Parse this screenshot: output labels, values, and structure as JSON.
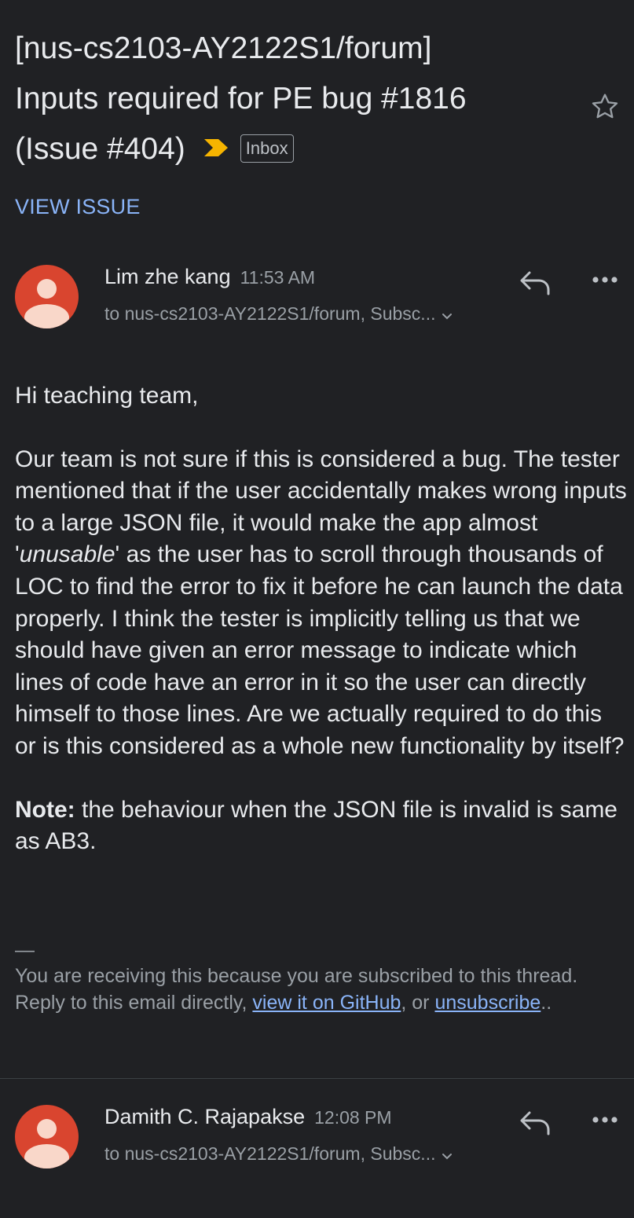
{
  "subject": {
    "line1": "[nus-cs2103-AY2122S1/forum]",
    "line2": "Inputs required for PE bug #1816",
    "line3": "(Issue #404)",
    "label": "Inbox",
    "important_icon": "important-marker-icon",
    "star_icon": "star-outline-icon"
  },
  "view_issue_label": "VIEW ISSUE",
  "messages": [
    {
      "sender": "Lim zhe kang",
      "time": "11:53 AM",
      "recipients": "to nus-cs2103-AY2122S1/forum, Subsc...",
      "greeting": "Hi teaching team,",
      "body_before_em": "Our team is not sure if this is considered a bug. The tester mentioned that if the user accidentally makes wrong inputs to a large JSON file, it would make the app almost '",
      "body_em": "unusable",
      "body_after_em": "' as the user has to scroll through thousands of LOC to find the error to fix it before he can launch the data properly. I think the tester is implicitly telling us that we should have given an error message to indicate which lines of code have an error in it so the user can directly himself to those lines. Are we actually required to do this or is this considered as a whole new functionality by itself?",
      "note_label": "Note:",
      "note_text": " the behaviour when the JSON file is invalid is same as AB3.",
      "footer_dash": "—",
      "footer_line1": "You are receiving this because you are subscribed to this thread.",
      "footer_reply_prefix": "Reply to this email directly, ",
      "footer_link_github": "view it on GitHub",
      "footer_middle": ", or ",
      "footer_link_unsub": "unsubscribe",
      "footer_end": ".."
    },
    {
      "sender": "Damith C. Rajapakse",
      "time": "12:08 PM",
      "recipients": "to nus-cs2103-AY2122S1/forum, Subsc..."
    }
  ],
  "colors": {
    "background": "#202124",
    "text": "#e8eaed",
    "secondary": "#9aa0a6",
    "link": "#8ab4f8",
    "avatar": "#d9452f",
    "important": "#f6b400"
  }
}
